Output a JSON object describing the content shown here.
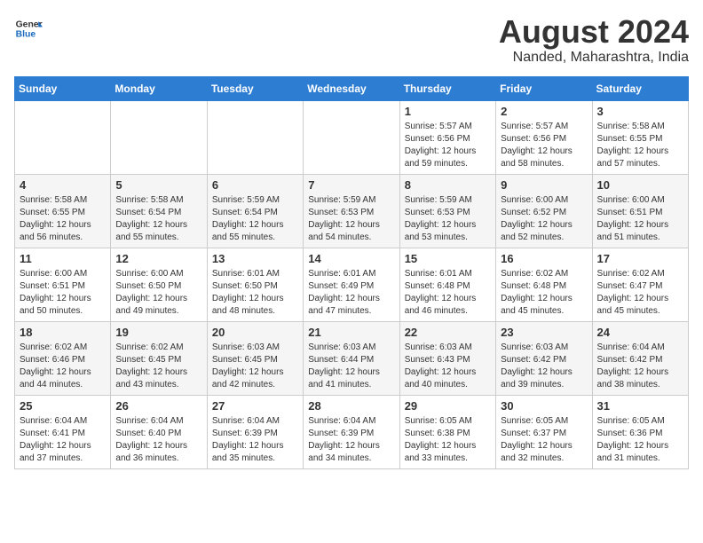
{
  "header": {
    "logo_line1": "General",
    "logo_line2": "Blue",
    "month_year": "August 2024",
    "location": "Nanded, Maharashtra, India"
  },
  "days_of_week": [
    "Sunday",
    "Monday",
    "Tuesday",
    "Wednesday",
    "Thursday",
    "Friday",
    "Saturday"
  ],
  "weeks": [
    [
      {
        "day": "",
        "info": ""
      },
      {
        "day": "",
        "info": ""
      },
      {
        "day": "",
        "info": ""
      },
      {
        "day": "",
        "info": ""
      },
      {
        "day": "1",
        "info": "Sunrise: 5:57 AM\nSunset: 6:56 PM\nDaylight: 12 hours\nand 59 minutes."
      },
      {
        "day": "2",
        "info": "Sunrise: 5:57 AM\nSunset: 6:56 PM\nDaylight: 12 hours\nand 58 minutes."
      },
      {
        "day": "3",
        "info": "Sunrise: 5:58 AM\nSunset: 6:55 PM\nDaylight: 12 hours\nand 57 minutes."
      }
    ],
    [
      {
        "day": "4",
        "info": "Sunrise: 5:58 AM\nSunset: 6:55 PM\nDaylight: 12 hours\nand 56 minutes."
      },
      {
        "day": "5",
        "info": "Sunrise: 5:58 AM\nSunset: 6:54 PM\nDaylight: 12 hours\nand 55 minutes."
      },
      {
        "day": "6",
        "info": "Sunrise: 5:59 AM\nSunset: 6:54 PM\nDaylight: 12 hours\nand 55 minutes."
      },
      {
        "day": "7",
        "info": "Sunrise: 5:59 AM\nSunset: 6:53 PM\nDaylight: 12 hours\nand 54 minutes."
      },
      {
        "day": "8",
        "info": "Sunrise: 5:59 AM\nSunset: 6:53 PM\nDaylight: 12 hours\nand 53 minutes."
      },
      {
        "day": "9",
        "info": "Sunrise: 6:00 AM\nSunset: 6:52 PM\nDaylight: 12 hours\nand 52 minutes."
      },
      {
        "day": "10",
        "info": "Sunrise: 6:00 AM\nSunset: 6:51 PM\nDaylight: 12 hours\nand 51 minutes."
      }
    ],
    [
      {
        "day": "11",
        "info": "Sunrise: 6:00 AM\nSunset: 6:51 PM\nDaylight: 12 hours\nand 50 minutes."
      },
      {
        "day": "12",
        "info": "Sunrise: 6:00 AM\nSunset: 6:50 PM\nDaylight: 12 hours\nand 49 minutes."
      },
      {
        "day": "13",
        "info": "Sunrise: 6:01 AM\nSunset: 6:50 PM\nDaylight: 12 hours\nand 48 minutes."
      },
      {
        "day": "14",
        "info": "Sunrise: 6:01 AM\nSunset: 6:49 PM\nDaylight: 12 hours\nand 47 minutes."
      },
      {
        "day": "15",
        "info": "Sunrise: 6:01 AM\nSunset: 6:48 PM\nDaylight: 12 hours\nand 46 minutes."
      },
      {
        "day": "16",
        "info": "Sunrise: 6:02 AM\nSunset: 6:48 PM\nDaylight: 12 hours\nand 45 minutes."
      },
      {
        "day": "17",
        "info": "Sunrise: 6:02 AM\nSunset: 6:47 PM\nDaylight: 12 hours\nand 45 minutes."
      }
    ],
    [
      {
        "day": "18",
        "info": "Sunrise: 6:02 AM\nSunset: 6:46 PM\nDaylight: 12 hours\nand 44 minutes."
      },
      {
        "day": "19",
        "info": "Sunrise: 6:02 AM\nSunset: 6:45 PM\nDaylight: 12 hours\nand 43 minutes."
      },
      {
        "day": "20",
        "info": "Sunrise: 6:03 AM\nSunset: 6:45 PM\nDaylight: 12 hours\nand 42 minutes."
      },
      {
        "day": "21",
        "info": "Sunrise: 6:03 AM\nSunset: 6:44 PM\nDaylight: 12 hours\nand 41 minutes."
      },
      {
        "day": "22",
        "info": "Sunrise: 6:03 AM\nSunset: 6:43 PM\nDaylight: 12 hours\nand 40 minutes."
      },
      {
        "day": "23",
        "info": "Sunrise: 6:03 AM\nSunset: 6:42 PM\nDaylight: 12 hours\nand 39 minutes."
      },
      {
        "day": "24",
        "info": "Sunrise: 6:04 AM\nSunset: 6:42 PM\nDaylight: 12 hours\nand 38 minutes."
      }
    ],
    [
      {
        "day": "25",
        "info": "Sunrise: 6:04 AM\nSunset: 6:41 PM\nDaylight: 12 hours\nand 37 minutes."
      },
      {
        "day": "26",
        "info": "Sunrise: 6:04 AM\nSunset: 6:40 PM\nDaylight: 12 hours\nand 36 minutes."
      },
      {
        "day": "27",
        "info": "Sunrise: 6:04 AM\nSunset: 6:39 PM\nDaylight: 12 hours\nand 35 minutes."
      },
      {
        "day": "28",
        "info": "Sunrise: 6:04 AM\nSunset: 6:39 PM\nDaylight: 12 hours\nand 34 minutes."
      },
      {
        "day": "29",
        "info": "Sunrise: 6:05 AM\nSunset: 6:38 PM\nDaylight: 12 hours\nand 33 minutes."
      },
      {
        "day": "30",
        "info": "Sunrise: 6:05 AM\nSunset: 6:37 PM\nDaylight: 12 hours\nand 32 minutes."
      },
      {
        "day": "31",
        "info": "Sunrise: 6:05 AM\nSunset: 6:36 PM\nDaylight: 12 hours\nand 31 minutes."
      }
    ]
  ]
}
